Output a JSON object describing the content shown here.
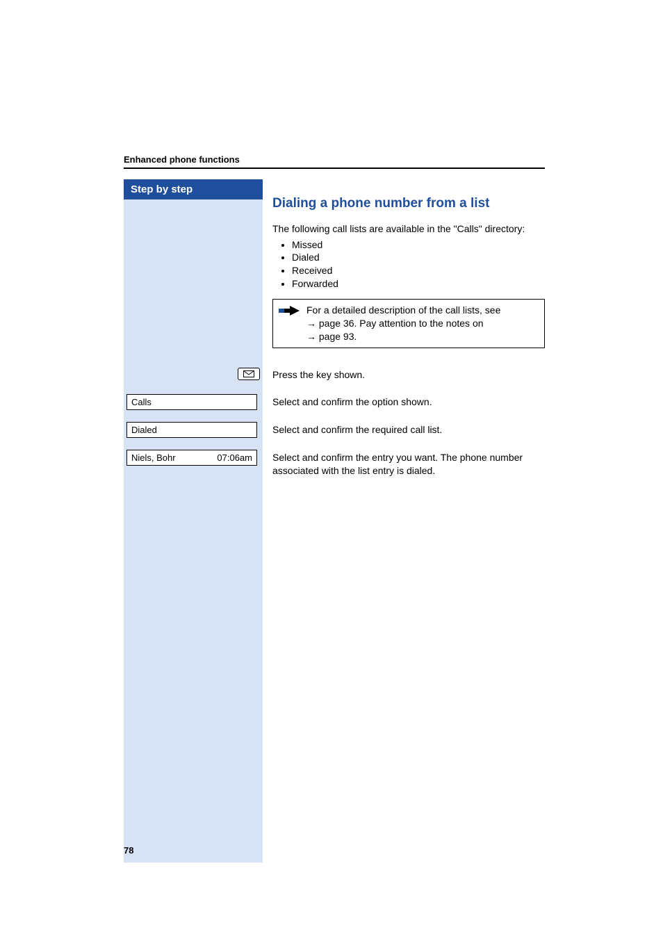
{
  "running_head": "Enhanced phone functions",
  "step_header": "Step by step",
  "section_title": "Dialing a phone number from a list",
  "intro": "The following call lists are available in the \"Calls\" directory:",
  "bullets": [
    "Missed",
    "Dialed",
    "Received",
    "Forwarded"
  ],
  "note": {
    "line1_prefix": "For a detailed description of the call lists, see ",
    "line1_arrow": "→",
    "line1_ref": " page 36. Pay attention to the notes on ",
    "line2_arrow": "→",
    "line2_ref": " page 93."
  },
  "steps": {
    "key": {
      "icon": "envelope-icon",
      "text": "Press the key shown."
    },
    "calls": {
      "label": "Calls",
      "text": "Select and confirm the option shown."
    },
    "dialed": {
      "label": "Dialed",
      "text": "Select and confirm the required call list."
    },
    "entry": {
      "name": "Niels, Bohr",
      "time": "07:06am",
      "text": "Select and confirm the entry you want. The phone number associated with the list entry is dialed."
    }
  },
  "page_number": "78"
}
